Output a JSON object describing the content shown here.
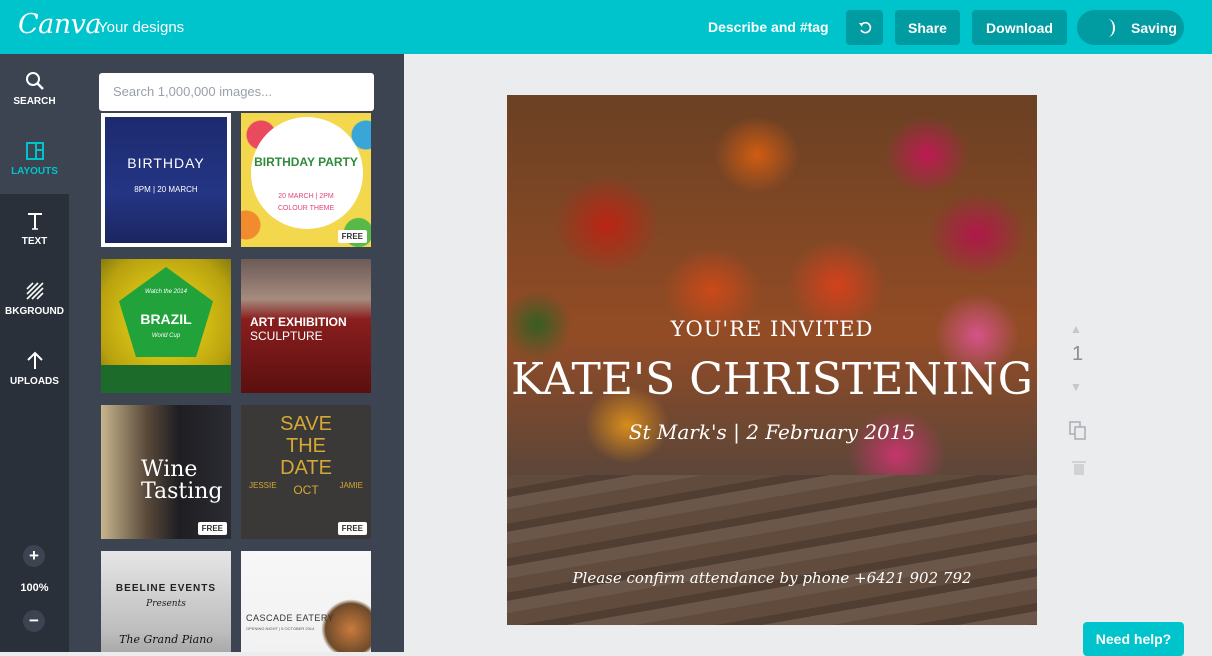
{
  "app": {
    "logo": "Canva",
    "your_designs": "Your designs"
  },
  "topbar": {
    "describe": "Describe and #tag",
    "share": "Share",
    "download": "Download",
    "saving": "Saving"
  },
  "rail": {
    "items": [
      {
        "label": "SEARCH",
        "icon": "search-icon"
      },
      {
        "label": "LAYOUTS",
        "icon": "layouts-icon"
      },
      {
        "label": "TEXT",
        "icon": "text-icon"
      },
      {
        "label": "BKGROUND",
        "icon": "background-icon"
      },
      {
        "label": "UPLOADS",
        "icon": "upload-icon"
      }
    ],
    "zoom": "100%"
  },
  "panel": {
    "search_placeholder": "Search 1,000,000 images...",
    "tiles": [
      {
        "title": "BIRTHDAY",
        "sub": "8PM | 20 MARCH",
        "free": ""
      },
      {
        "title": "BIRTHDAY PARTY",
        "sub": "20 MARCH | 2PM",
        "sub2": "COLOUR THEME",
        "free": "FREE"
      },
      {
        "title": "BRAZIL",
        "sub": "Watch the 2014",
        "sub2": "World Cup",
        "free": ""
      },
      {
        "title": "ART EXHIBITION",
        "sub": "SCULPTURE",
        "free": ""
      },
      {
        "title": "Wine",
        "sub": "Tasting",
        "free": "FREE"
      },
      {
        "title": "SAVE THE DATE",
        "sub": "JESSIE",
        "sub2": "OCT",
        "sub3": "JAMIE",
        "free": "FREE"
      },
      {
        "title": "BEELINE EVENTS",
        "sub": "Presents",
        "sub2": "The Grand Piano",
        "free": ""
      },
      {
        "title": "CASCADE EATERY",
        "sub": "OPENING NIGHT | 5 OCTOBER 2014",
        "free": ""
      }
    ]
  },
  "design": {
    "invited": "YOU'RE INVITED",
    "title": "KATE'S CHRISTENING",
    "place": "St Mark's | 2 February 2015",
    "rsvp": "Please confirm attendance by phone +6421 902 792"
  },
  "page_number": "1",
  "help": "Need help?"
}
